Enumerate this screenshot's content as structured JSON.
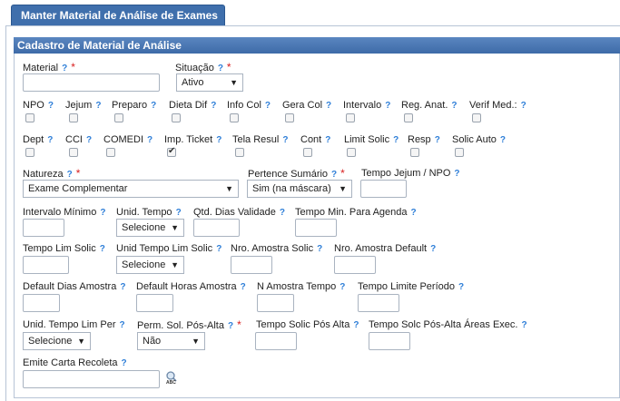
{
  "page": {
    "tab_title": "Manter Material de Análise de Exames"
  },
  "panel": {
    "title": "Cadastro de Material de Análise"
  },
  "help_glyph": "?",
  "required_glyph": "*",
  "fields": {
    "material": {
      "label": "Material"
    },
    "situacao": {
      "label": "Situação",
      "value": "Ativo"
    },
    "npo": {
      "label": "NPO"
    },
    "jejum": {
      "label": "Jejum"
    },
    "preparo": {
      "label": "Preparo"
    },
    "dieta_dif": {
      "label": "Dieta Dif"
    },
    "info_col": {
      "label": "Info Col"
    },
    "gera_col": {
      "label": "Gera Col"
    },
    "intervalo": {
      "label": "Intervalo"
    },
    "reg_anat": {
      "label": "Reg. Anat."
    },
    "verif_med": {
      "label": "Verif Med.:"
    },
    "dept": {
      "label": "Dept"
    },
    "cci": {
      "label": "CCI"
    },
    "comedi": {
      "label": "COMEDI"
    },
    "imp_ticket": {
      "label": "Imp. Ticket",
      "checked": true
    },
    "tela_resul": {
      "label": "Tela Resul"
    },
    "cont": {
      "label": "Cont"
    },
    "limit_solic": {
      "label": "Limit Solic"
    },
    "resp": {
      "label": "Resp"
    },
    "solic_auto": {
      "label": "Solic Auto"
    },
    "natureza": {
      "label": "Natureza",
      "value": "Exame Complementar"
    },
    "pertence_sumario": {
      "label": "Pertence Sumário",
      "value": "Sim (na máscara)"
    },
    "tempo_jejum_npo": {
      "label": "Tempo Jejum / NPO"
    },
    "intervalo_minimo": {
      "label": "Intervalo Mínimo"
    },
    "unid_tempo": {
      "label": "Unid. Tempo",
      "value": "Selecione"
    },
    "qtd_dias_validade": {
      "label": "Qtd. Dias Validade"
    },
    "tempo_min_agenda": {
      "label": "Tempo Min. Para Agenda"
    },
    "tempo_lim_solic": {
      "label": "Tempo Lim Solic"
    },
    "unid_tempo_lim_solic": {
      "label": "Unid Tempo Lim Solic",
      "value": "Selecione"
    },
    "nro_amostra_solic": {
      "label": "Nro. Amostra Solic"
    },
    "nro_amostra_default": {
      "label": "Nro. Amostra Default"
    },
    "default_dias_amostra": {
      "label": "Default Dias Amostra"
    },
    "default_horas_amostra": {
      "label": "Default Horas Amostra"
    },
    "n_amostra_tempo": {
      "label": "N Amostra Tempo"
    },
    "tempo_limite_periodo": {
      "label": "Tempo Limite Período"
    },
    "unid_tempo_lim_per": {
      "label": "Unid. Tempo Lim Per",
      "value": "Selecione"
    },
    "perm_sol_pos_alta": {
      "label": "Perm. Sol. Pós-Alta",
      "value": "Não"
    },
    "tempo_solic_pos_alta": {
      "label": "Tempo Solic Pós Alta"
    },
    "tempo_solc_pos_alta_areas": {
      "label": "Tempo Solc Pós-Alta Áreas Exec."
    },
    "emite_carta_recoleta": {
      "label": "Emite Carta Recoleta"
    }
  },
  "icons": {
    "lookup": "search-abc-icon",
    "lookup_text": "ABC"
  },
  "colors": {
    "header": "#3f6fac",
    "help": "#2f7fd8",
    "required": "#d81e1e"
  }
}
